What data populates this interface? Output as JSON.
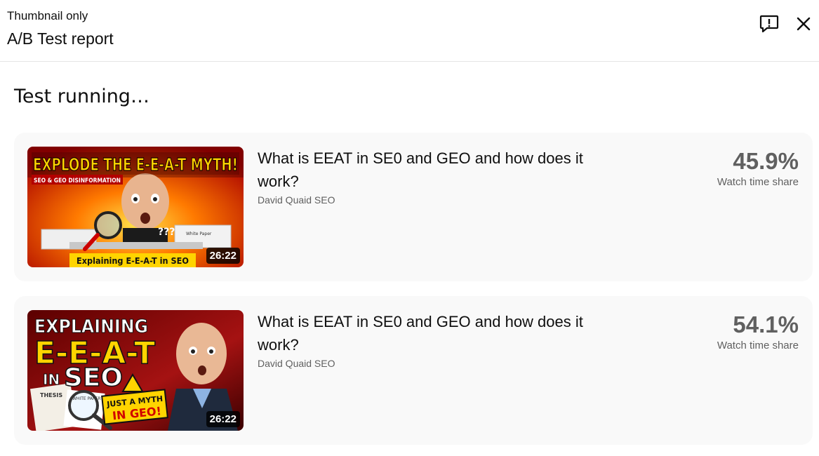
{
  "header": {
    "subtitle": "Thumbnail only",
    "title": "A/B Test report",
    "feedback_icon": "feedback-icon",
    "close_icon": "close-icon"
  },
  "status": "Test running…",
  "variants": [
    {
      "title": "What is EEAT in SE0 and GEO and how does it work?",
      "channel": "David Quaid SEO",
      "duration": "26:22",
      "metric_value": "45.9%",
      "metric_label": "Watch time share",
      "thumb_text": {
        "headline": "EXPLODE THE E-E-A-T MYTH!",
        "tag": "SEO & GEO DISINFORMATION",
        "footer": "Explaining E-E-A-T in SEO",
        "paper": "White Paper",
        "marks": "???"
      }
    },
    {
      "title": "What is EEAT in SE0 and GEO and how does it work?",
      "channel": "David Quaid SEO",
      "duration": "26:22",
      "metric_value": "54.1%",
      "metric_label": "Watch time share",
      "thumb_text": {
        "line1": "EXPLAINING",
        "line2": "E-E-A-T",
        "line3_small": "IN",
        "line3_big": "SEO",
        "thesis": "THESIS",
        "paper": "WHITE PAPER",
        "callout1": "JUST A MYTH",
        "callout2": "IN GEO!"
      }
    }
  ],
  "colors": {
    "card_bg": "#f9f9f9",
    "metric_text": "#606060",
    "thumb1_yellow": "#ffd400",
    "thumb2_bg": "#8e1010"
  }
}
